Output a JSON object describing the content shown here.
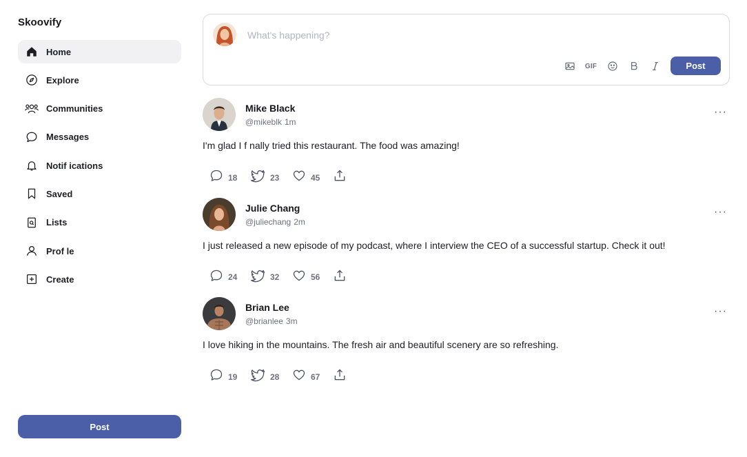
{
  "app": {
    "name": "Skoovify"
  },
  "sidebar": {
    "items": [
      {
        "label": "Home",
        "icon": "home-icon",
        "active": true
      },
      {
        "label": "Explore",
        "icon": "compass-icon"
      },
      {
        "label": "Communities",
        "icon": "people-icon"
      },
      {
        "label": "Messages",
        "icon": "chat-bubble-icon"
      },
      {
        "label": "Notif ications",
        "icon": "bell-icon"
      },
      {
        "label": "Saved",
        "icon": "bookmark-icon"
      },
      {
        "label": "Lists",
        "icon": "list-icon"
      },
      {
        "label": "Prof le",
        "icon": "user-icon"
      },
      {
        "label": "Create",
        "icon": "plus-square-icon"
      }
    ],
    "post_button": "Post"
  },
  "composer": {
    "placeholder": "What's happening?",
    "tools": [
      "image-icon",
      "GIF",
      "emoji-icon",
      "bold-icon",
      "italic-icon"
    ],
    "post_button": "Post"
  },
  "posts": [
    {
      "name": "Mike Black",
      "handle": "@mikeblk",
      "time": "1m",
      "text": "I'm glad I f nally tried this restaurant. The food was amazing!",
      "comments": "18",
      "retweets": "23",
      "likes": "45"
    },
    {
      "name": "Julie Chang",
      "handle": "@juliechang",
      "time": "2m",
      "text": "I just released a new episode of my podcast, where I interview the CEO of a successful startup. Check it out!",
      "comments": "24",
      "retweets": "32",
      "likes": "56"
    },
    {
      "name": "Brian Lee",
      "handle": "@brianlee",
      "time": "3m",
      "text": "I love hiking in the mountains. The fresh air and beautiful scenery are so refreshing.",
      "comments": "19",
      "retweets": "28",
      "likes": "67"
    }
  ],
  "colors": {
    "accent": "#4a5fa8",
    "muted": "#6e7080",
    "active_bg": "#f1f1f4"
  }
}
